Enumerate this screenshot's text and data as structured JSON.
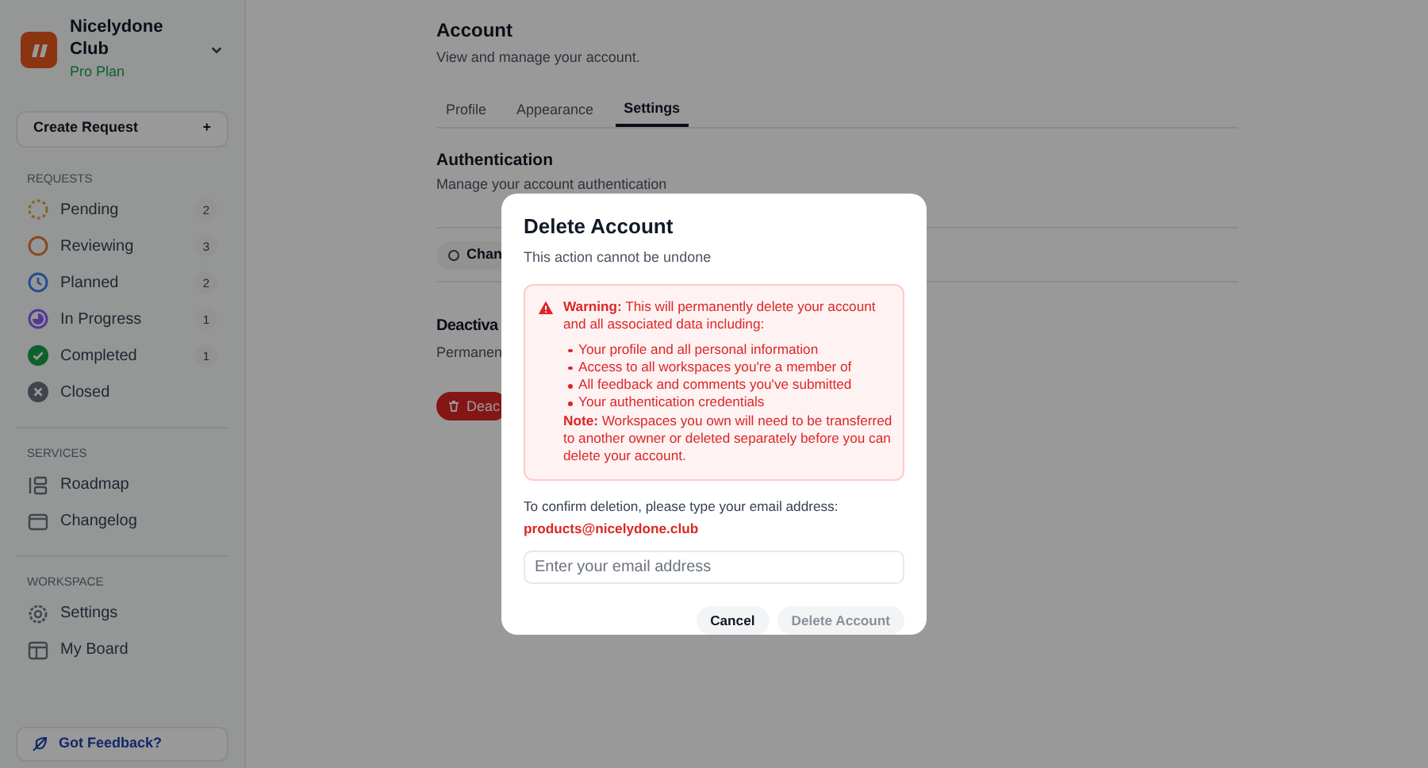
{
  "workspace": {
    "name": "Nicelydone Club",
    "plan": "Pro Plan"
  },
  "create_button": {
    "label": "Create Request",
    "icon": "+"
  },
  "sections": [
    {
      "title": "REQUESTS",
      "items": [
        {
          "label": "Pending",
          "kind": "pending",
          "count": "2"
        },
        {
          "label": "Reviewing",
          "kind": "reviewing",
          "count": "3"
        },
        {
          "label": "Planned",
          "kind": "planned",
          "count": "2"
        },
        {
          "label": "In Progress",
          "kind": "progress",
          "count": "1"
        },
        {
          "label": "Completed",
          "kind": "completed",
          "count": "1"
        },
        {
          "label": "Closed",
          "kind": "closed"
        }
      ]
    },
    {
      "title": "SERVICES",
      "items": [
        {
          "label": "Roadmap",
          "kind": "roadmap"
        },
        {
          "label": "Changelog",
          "kind": "changelog"
        }
      ]
    },
    {
      "title": "WORKSPACE",
      "items": [
        {
          "label": "Settings",
          "kind": "settings"
        },
        {
          "label": "My Board",
          "kind": "board"
        }
      ]
    }
  ],
  "feedback_button": {
    "label": "Got Feedback?"
  },
  "page": {
    "title": "Account",
    "subtitle": "View and manage your account.",
    "tabs": [
      {
        "label": "Profile",
        "selected": false
      },
      {
        "label": "Appearance",
        "selected": false
      },
      {
        "label": "Settings",
        "selected": true
      }
    ],
    "authentication": {
      "title": "Authentication",
      "subtitle": "Manage your account authentication",
      "button": "Chan"
    },
    "deactivate": {
      "title": "Deactiva",
      "subtitle": "Permanen",
      "button": "Deac"
    }
  },
  "dialog": {
    "title": "Delete Account",
    "subtitle": "This action cannot be undone",
    "warning": "**Warning:** This will permanently delete your account and all associated data including:",
    "bullets": [
      "Your profile and all personal information",
      "Access to all workspaces you're a member of",
      "All feedback and comments you've submitted",
      "Your authentication credentials"
    ],
    "note": "**Note:** Workspaces you own will need to be transferred to another owner or deleted separately before you can delete your account.",
    "confirm_text": "To confirm deletion, please type your email address:",
    "email": "products@nicelydone.club",
    "input": {
      "placeholder": "Enter your email address"
    },
    "buttons": [
      {
        "label": "Cancel",
        "disabled": false
      },
      {
        "label": "Delete Account",
        "disabled": true
      }
    ]
  }
}
